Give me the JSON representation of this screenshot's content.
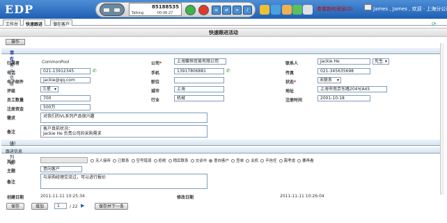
{
  "app": {
    "logo": "EDP",
    "phone_number": "85188535",
    "phone_status": "Talking",
    "phone_time": "00:06:27",
    "messages": "查看新的消息(2)",
    "user": "James , James , 欢迎 · 上海分公司"
  },
  "tabs": [
    "工作台",
    "快速跟进",
    "潜在客户"
  ],
  "page_title": "快速跟进活动",
  "operate": "操作",
  "section1": {
    "title": "潜在客户信息",
    "link": "查看"
  },
  "fields": {
    "owner": {
      "label": "归属者",
      "value": "CommonPool"
    },
    "company": {
      "label": "公司",
      "value": "上海蝶恒贸易有限公司"
    },
    "contact": {
      "label": "联系人",
      "value": "Jackie He",
      "title_select": "先生"
    },
    "phone": {
      "label": "电话",
      "value": "021-13912345"
    },
    "mobile": {
      "label": "手机",
      "value": "13917806881"
    },
    "fax": {
      "label": "传真",
      "value": "021-345635698"
    },
    "email": {
      "label": "电子邮件",
      "value": "jackie@qq.com"
    },
    "position": {
      "label": "职位",
      "value": ""
    },
    "status": {
      "label": "状态",
      "value": "未联系"
    },
    "rating": {
      "label": "评级",
      "value": "三星"
    },
    "city": {
      "label": "城市",
      "value": "上海"
    },
    "address": {
      "label": "地址",
      "value": "上海市南京东路204号A45"
    },
    "employees": {
      "label": "员工数量",
      "value": "700"
    },
    "industry": {
      "label": "行业",
      "value": "机械"
    },
    "reg_time": {
      "label": "注册时间",
      "value": "2001-10-18"
    },
    "reg_capital": {
      "label": "注册资金",
      "value": "500万"
    },
    "demand": {
      "label": "需求",
      "value": "对我们的VL系列产品很兴趣"
    },
    "note": {
      "label": "备注",
      "value": "客户目前状况：\nJackie He 负责公司的采购需求"
    }
  },
  "section2": {
    "title": "活动列表",
    "count": "(5)"
  },
  "section3": {
    "title": "跟进信息"
  },
  "follow": {
    "other_label": "其他",
    "options": [
      "无人接听",
      "已联系",
      "空号错误",
      "拒绝",
      "稍后联系",
      "交谈中",
      "意向客户",
      "签单",
      "关机",
      "不信任",
      "需考虑",
      "要再看"
    ],
    "selected": 6,
    "subject": {
      "label": "主题",
      "value": "意向客户"
    },
    "note": {
      "label": "备注",
      "value": "与采购经理交流过，可以进行报价"
    },
    "created": {
      "label": "创建日期",
      "value": "2011-11-11 10:25:34"
    },
    "modified": {
      "label": "修改日期",
      "value": "2011-11-11 10:26:04"
    }
  },
  "footer": {
    "save": "保存",
    "add": "增加",
    "page": "1",
    "total": "/ 22",
    "save_next": "保存并下一条"
  }
}
